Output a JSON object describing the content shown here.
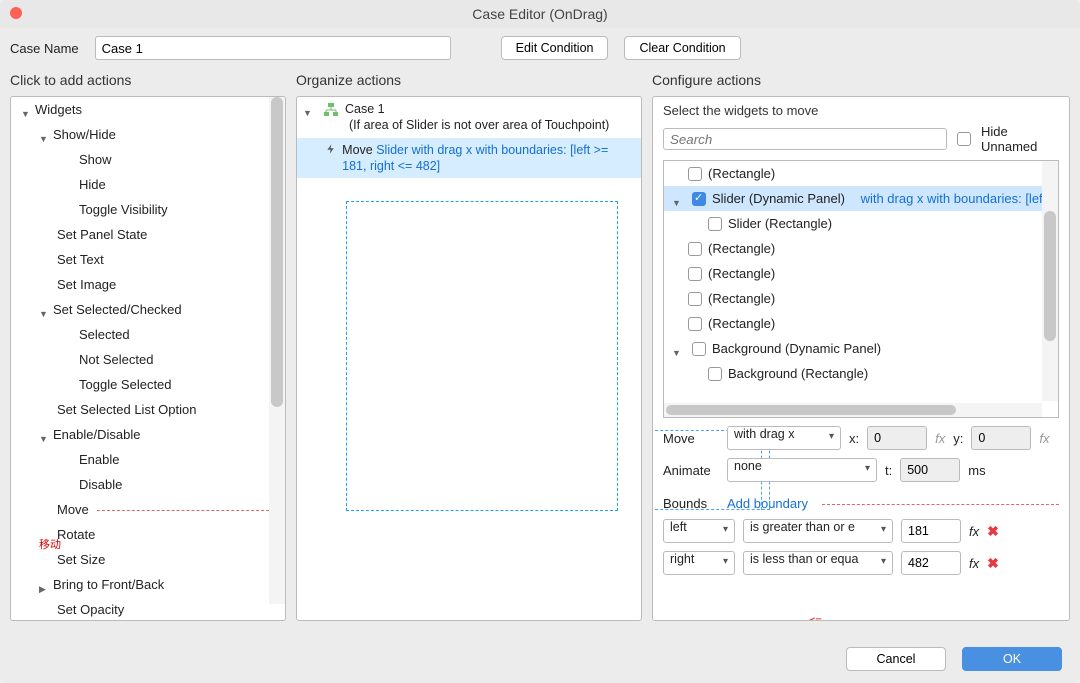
{
  "title": "Case Editor (OnDrag)",
  "caseNameLabel": "Case Name",
  "caseName": "Case 1",
  "buttons": {
    "editCondition": "Edit Condition",
    "clearCondition": "Clear Condition",
    "cancel": "Cancel",
    "ok": "OK"
  },
  "headers": {
    "actions": "Click to add actions",
    "organize": "Organize actions",
    "configure": "Configure actions"
  },
  "actionsTree": {
    "root": "Widgets",
    "groups": {
      "showHide": {
        "label": "Show/Hide",
        "items": [
          "Show",
          "Hide",
          "Toggle Visibility"
        ]
      },
      "setPanelState": "Set Panel State",
      "setText": "Set Text",
      "setImage": "Set Image",
      "selChecked": {
        "label": "Set Selected/Checked",
        "items": [
          "Selected",
          "Not Selected",
          "Toggle Selected",
          "Set Selected List Option"
        ]
      },
      "enableDisable": {
        "label": "Enable/Disable",
        "items": [
          "Enable",
          "Disable"
        ]
      },
      "move": "Move",
      "rotate": "Rotate",
      "setSize": "Set Size",
      "bringFB": "Bring to Front/Back",
      "setOpacity": "Set Opacity"
    }
  },
  "annotations": {
    "move": "移动",
    "bounds": "界限",
    "gte": ">=",
    "lte": "<="
  },
  "organize": {
    "caseTitle": "Case 1",
    "condition": "(If area of Slider is not over area of Touchpoint)",
    "actionName": "Move",
    "actionTarget": "Slider with drag x with boundaries: [left >= 181, right <= 482]"
  },
  "configure": {
    "selectWidgets": "Select the widgets to move",
    "searchPlaceholder": "Search",
    "hideUnnamed": "Hide Unnamed",
    "widgets": {
      "rect1": "(Rectangle)",
      "sliderDP": "Slider (Dynamic Panel)",
      "sliderDPDesc": "with drag x with boundaries: [lef",
      "sliderRect": "Slider (Rectangle)",
      "rect2": "(Rectangle)",
      "rect3": "(Rectangle)",
      "rect4": "(Rectangle)",
      "rect5": "(Rectangle)",
      "bgDP": "Background (Dynamic Panel)",
      "bgRect": "Background (Rectangle)"
    },
    "moveLabel": "Move",
    "moveMode": "with drag x",
    "xLabel": "x:",
    "xVal": "0",
    "yLabel": "y:",
    "yVal": "0",
    "animateLabel": "Animate",
    "animateMode": "none",
    "tLabel": "t:",
    "tVal": "500",
    "ms": "ms",
    "boundsLabel": "Bounds",
    "addBoundary": "Add boundary",
    "b1Edge": "left",
    "b1Op": "is greater than or e",
    "b1Val": "181",
    "b2Edge": "right",
    "b2Op": "is less than or equa",
    "b2Val": "482"
  }
}
